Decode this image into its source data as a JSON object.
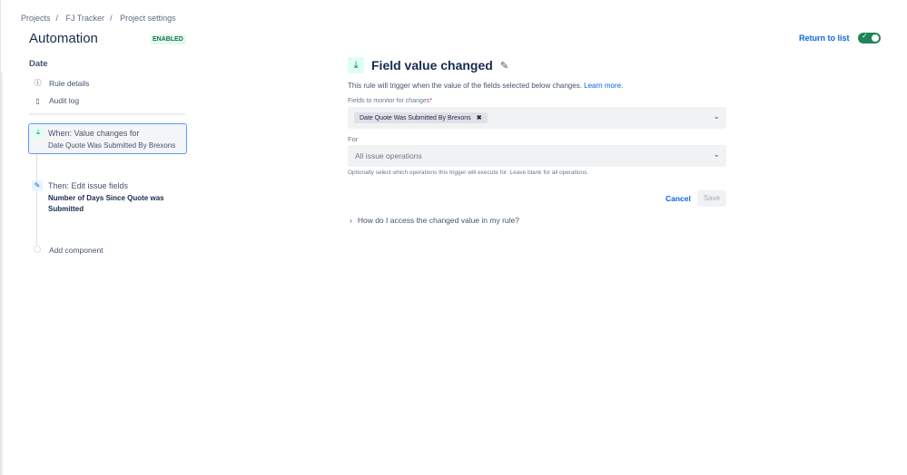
{
  "breadcrumbs": [
    "Projects",
    "FJ Tracker",
    "Project settings"
  ],
  "header": {
    "title": "Automation",
    "status": "ENABLED",
    "return_label": "Return to list",
    "toggle_on": true
  },
  "sidebar": {
    "rule_name": "Date",
    "items": [
      {
        "label": "Rule details",
        "icon": "info-icon"
      },
      {
        "label": "Audit log",
        "icon": "document-icon"
      }
    ],
    "trigger": {
      "title": "When: Value changes for",
      "subtitle": "Date Quote Was Submitted By Brexons"
    },
    "action": {
      "title": "Then: Edit issue fields",
      "subtitle": "Number of Days Since Quote was Submitted"
    },
    "add_label": "Add component"
  },
  "panel": {
    "title": "Field value changed",
    "description": "This rule will trigger when the value of the fields selected below changes.",
    "learn_more": "Learn more.",
    "fields_label": "Fields to monitor for changes",
    "required_mark": "*",
    "selected_field": "Date Quote Was Submitted By Brexons",
    "for_label": "For",
    "for_placeholder": "All issue operations",
    "for_help": "Optionally select which operations this trigger will execute for. Leave blank for all operations.",
    "cancel": "Cancel",
    "save": "Save",
    "faq": "How do I access the changed value in my rule?"
  }
}
